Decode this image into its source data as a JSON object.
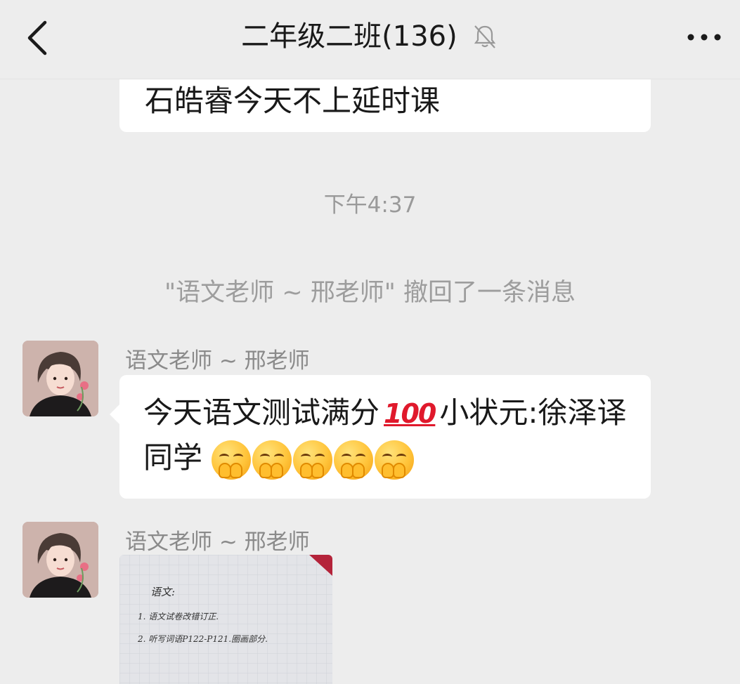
{
  "header": {
    "title": "二年级二班(136)",
    "back_icon": "chevron-left-icon",
    "mute_icon": "bell-muted-icon",
    "more_icon": "more-dots-icon"
  },
  "messages": {
    "previous_text": "石皓睿今天不上延时课",
    "time": "下午4:37",
    "recall_notice": "\"语文老师 ~ 邢老师\" 撤回了一条消息",
    "teacher_name_1": "语文老师 ~ 邢老师",
    "announcement_part1": "今天语文测试满分",
    "hundred_emoji": "100",
    "announcement_part2": "小状元:徐泽译同学",
    "hug_emoji_count": 5,
    "teacher_name_2": "语文老师 ~ 邢老师",
    "photo": {
      "heading": "语文:",
      "line1": "1. 语文试卷改错订正.",
      "line2": "2. 听写词语P122-P121.圈画部分."
    }
  },
  "colors": {
    "background": "#ededed",
    "bubble": "#ffffff",
    "meta_text": "#9a9a9a"
  }
}
